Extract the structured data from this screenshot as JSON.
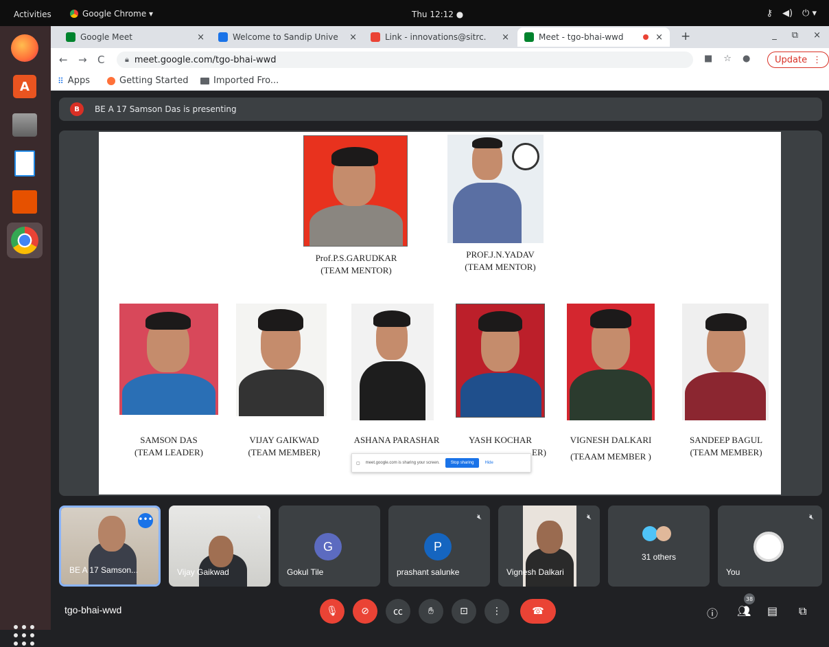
{
  "topbar": {
    "activities": "Activities",
    "app_name": "Google Chrome ▾",
    "clock": "Thu 12:12 ●",
    "tray": [
      "⚷",
      "◀)",
      "⏻ ▾"
    ]
  },
  "tabs": [
    {
      "label": "Google Meet",
      "color": "#00832d"
    },
    {
      "label": "Welcome to Sandip Unive",
      "color": "#1a73e8"
    },
    {
      "label": "Link - innovations@sitrc.",
      "color": "#ea4335"
    },
    {
      "label": "Meet - tgo-bhai-wwd",
      "color": "#00832d"
    }
  ],
  "tab_close": "×",
  "new_tab": "+",
  "window_controls": [
    "_",
    "⧉",
    "×"
  ],
  "nav": {
    "back": "←",
    "forward": "→",
    "reload": "C"
  },
  "url": "meet.google.com/tgo-bhai-wwd",
  "update_label": "Update",
  "update_menu": "⋮",
  "bookmarks": [
    {
      "label": "Apps"
    },
    {
      "label": "Getting Started"
    },
    {
      "label": "Imported Fro..."
    }
  ],
  "presenting": {
    "initial": "B",
    "text": "BE A 17 Samson Das is presenting"
  },
  "slide": {
    "mentors": [
      {
        "name": "Prof.P.S.GARUDKAR",
        "role": "(TEAM MENTOR)"
      },
      {
        "name": "PROF.J.N.YADAV",
        "role": "(TEAM MENTOR)"
      }
    ],
    "members": [
      {
        "name": "SAMSON DAS",
        "role": "(TEAM LEADER)"
      },
      {
        "name": "VIJAY GAIKWAD",
        "role": "(TEAM MEMBER)"
      },
      {
        "name": "ASHANA PARASHAR",
        "role": ""
      },
      {
        "name": "YASH KOCHAR",
        "role": "ER)"
      },
      {
        "name": "VIGNESH DALKARI",
        "role": "(TEAAM MEMBER )"
      },
      {
        "name": "SANDEEP BAGUL",
        "role": "(TEAM MEMBER)"
      }
    ],
    "share_bar": {
      "text": "meet.google.com is sharing your screen.",
      "stop": "Stop sharing",
      "hide": "Hide"
    }
  },
  "participants": [
    {
      "name": "BE A 17 Samson...",
      "letter": "",
      "color": ""
    },
    {
      "name": "Vijay Gaikwad",
      "letter": "",
      "color": ""
    },
    {
      "name": "Gokul Tile",
      "letter": "G",
      "color": "#5c6bc0"
    },
    {
      "name": "prashant salunke",
      "letter": "P",
      "color": "#1565c0"
    },
    {
      "name": "Vignesh Dalkari",
      "letter": "",
      "color": ""
    },
    {
      "name": "31 others",
      "letter": "",
      "color": ""
    },
    {
      "name": "You",
      "letter": "",
      "color": ""
    }
  ],
  "meeting_code": "tgo-bhai-wwd",
  "participant_count": "38"
}
